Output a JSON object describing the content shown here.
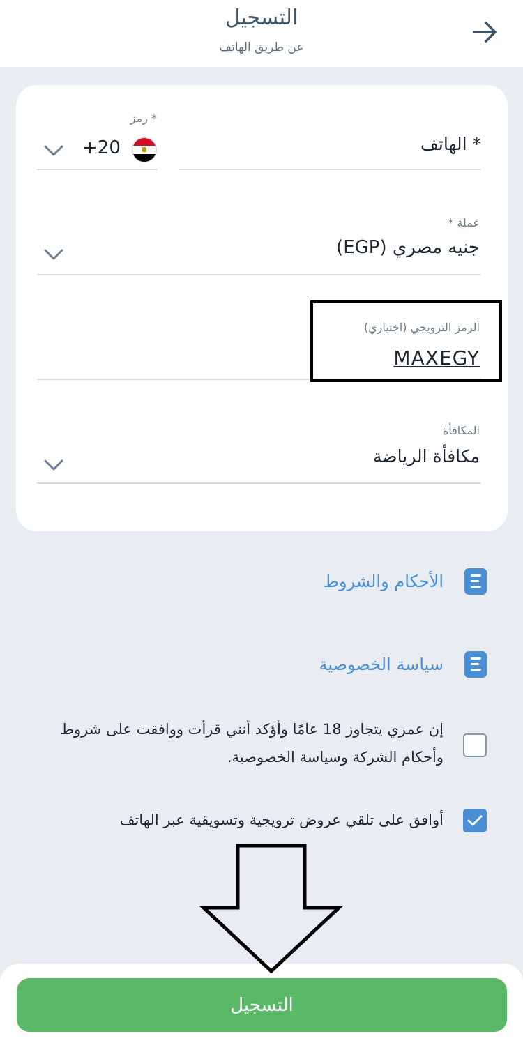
{
  "header": {
    "title": "التسجيل",
    "subtitle": "عن طريق الهاتف",
    "back_icon": "arrow-right-icon"
  },
  "form": {
    "phone": {
      "label": "* الهاتف",
      "value": ""
    },
    "country_code": {
      "label": "* رمز",
      "value": "+20",
      "flag": "egypt-flag-icon"
    },
    "currency": {
      "label": "عملة *",
      "value": "جنيه مصري (EGP)"
    },
    "promo": {
      "label": "الرمز الترويجي (اختياري)",
      "value": "MAXEGY"
    },
    "bonus": {
      "label": "المكافأة",
      "value": "مكافأة الرياضة"
    }
  },
  "links": {
    "terms": "الأحكام والشروط",
    "privacy": "سياسة الخصوصية"
  },
  "consents": {
    "age": {
      "text": "إن عمري يتجاوز 18 عامًا وأؤكد أنني قرأت ووافقت على شروط وأحكام الشركة وسياسة الخصوصية.",
      "checked": false
    },
    "marketing": {
      "text": "أوافق على تلقي عروض ترويجية وتسويقية عبر الهاتف",
      "checked": true
    }
  },
  "submit_label": "التسجيل",
  "colors": {
    "accent": "#4a8fd4",
    "button": "#58b866",
    "background": "#e9edf2"
  }
}
